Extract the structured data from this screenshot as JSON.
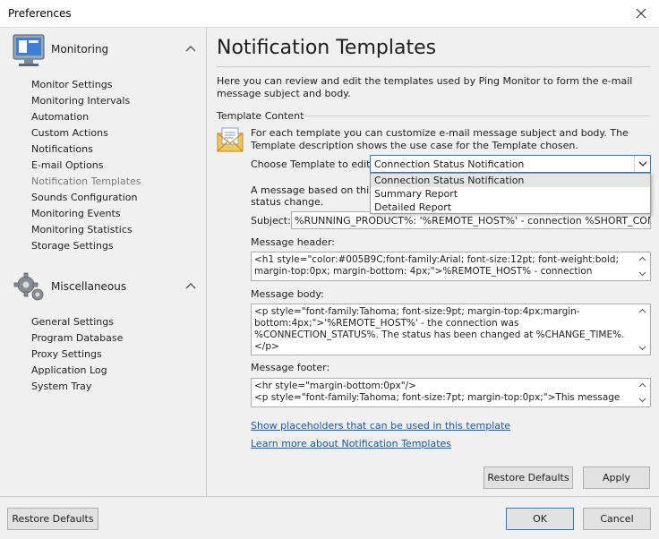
{
  "window": {
    "title": "Preferences"
  },
  "sidebar": {
    "sections": [
      {
        "label": "Monitoring",
        "items": [
          "Monitor Settings",
          "Monitoring Intervals",
          "Automation",
          "Custom Actions",
          "Notifications",
          "E-mail Options",
          "Notification Templates",
          "Sounds Configuration",
          "Monitoring Events",
          "Monitoring Statistics",
          "Storage Settings"
        ]
      },
      {
        "label": "Miscellaneous",
        "items": [
          "General Settings",
          "Program Database",
          "Proxy Settings",
          "Application Log",
          "System Tray"
        ]
      }
    ],
    "active_item": "Notification Templates"
  },
  "main": {
    "heading": "Notification Templates",
    "intro": "Here you can review and edit the templates used by Ping Monitor to form the e-mail message subject and body.",
    "group_label": "Template Content",
    "description": "For each template you can customize e-mail message subject and body. The Template description shows the use case for the Template chosen.",
    "choose_label": "Choose Template to edit:",
    "selected_template": "Connection Status Notification",
    "template_options": [
      "Connection Status Notification",
      "Summary Report",
      "Detailed Report"
    ],
    "message_note": "A message based on this t\nstatus change.",
    "subject_label": "Subject:",
    "subject_value": "%RUNNING_PRODUCT%: '%REMOTE_HOST%' - connection %SHORT_CONNECTION_STATUS%",
    "header_label": "Message header:",
    "header_value": "<h1 style=\"color:#005B9C;font-family:Arial; font-size:12pt; font-weight:bold; margin-top:0px; margin-bottom: 4px;\">%REMOTE_HOST% - connection",
    "body_label": "Message body:",
    "body_value": "<p style=\"font-family:Tahoma; font-size:9pt; margin-top:4px;margin-bottom:4px;\">'%REMOTE_HOST%' - the connection was %CONNECTION_STATUS%. The status has been changed at %CHANGE_TIME%.</p>",
    "footer_label": "Message footer:",
    "footer_value": "<hr style=\"margin-bottom:0px\"/>\n<p style=\"font-family:Tahoma; font-size:7pt; margin-top:0px;\">This message was",
    "link_placeholders": "Show placeholders that can be used in this template",
    "link_learn": "Learn more about Notification Templates",
    "restore_button": "Restore Defaults",
    "apply_button": "Apply"
  },
  "footer": {
    "restore_button": "Restore Defaults",
    "ok_button": "OK",
    "cancel_button": "Cancel"
  },
  "icons": {
    "monitoring": "monitor-icon",
    "misc": "gear-icon",
    "template": "envelope-icon"
  },
  "colors": {
    "accent": "#2f79c5",
    "link": "#1558b0"
  }
}
